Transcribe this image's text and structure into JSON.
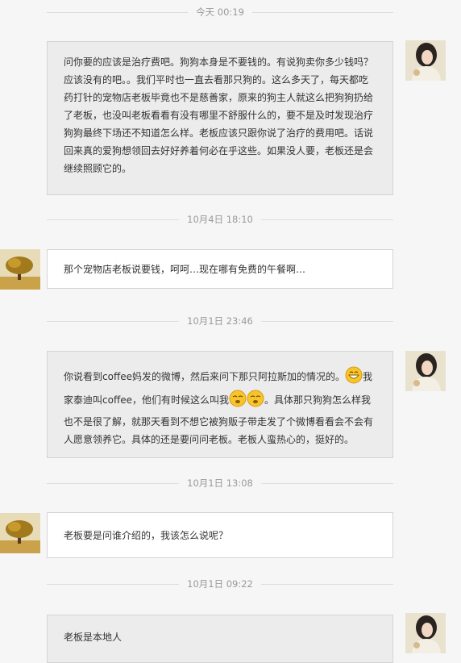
{
  "conversation": {
    "stamps": [
      "今天  00:19",
      "10月4日  18:10",
      "10月1日  23:46",
      "10月1日  13:08",
      "10月1日  09:22"
    ],
    "msg1": {
      "text": "问你要的应该是治疗费吧。狗狗本身是不要钱的。有说狗卖你多少钱吗？应该没有的吧。。我们平时也一直去看那只狗的。这么多天了，每天都吃药打针的宠物店老板毕竟也不是慈善家，原来的狗主人就这么把狗狗扔给了老板，也没叫老板看看有没有哪里不舒服什么的，要不是及时发现治疗狗狗最终下场还不知道怎么样。老板应该只跟你说了治疗的费用吧。话说回来真的爱狗想领回去好好养着何必在乎这些。如果没人要，老板还是会继续照顾它的。"
    },
    "msg2": {
      "text": "那个宠物店老板说要钱，呵呵…现在哪有免费的午餐啊…"
    },
    "msg3": {
      "part1": "你说看到coffee妈发的微博，然后来问下那只阿拉斯加的情况的。",
      "part2": "我家泰迪叫coffee，他们有时候这么叫我",
      "part3": "。具体那只狗狗怎么样我也不是很了解，就那天看到不想它被狗贩子带走发了个微博看看会不会有人愿意领养它。具体的还是要问问老板。老板人蛮热心的，挺好的。"
    },
    "msg4": {
      "text": "老板要是问谁介绍的，我该怎么说呢？"
    },
    "msg5": {
      "text": "老板是本地人"
    }
  }
}
